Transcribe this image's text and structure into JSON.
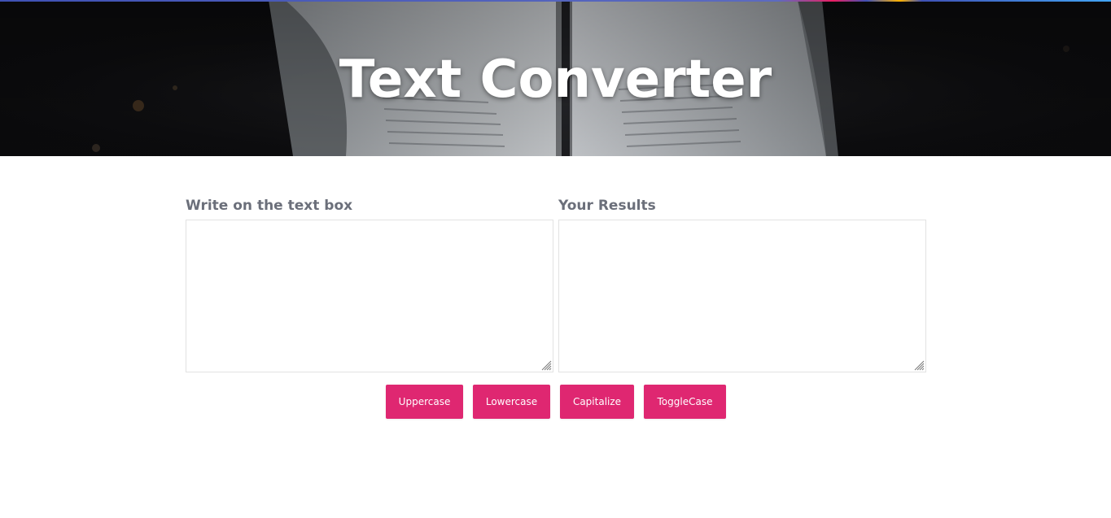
{
  "header": {
    "title": "Text Converter"
  },
  "converter": {
    "input_label": "Write on the text box",
    "output_label": "Your Results",
    "input_value": "",
    "output_value": ""
  },
  "actions": {
    "uppercase": "Uppercase",
    "lowercase": "Lowercase",
    "capitalize": "Capitalize",
    "togglecase": "ToggleCase"
  },
  "colors": {
    "button": "#df2771",
    "label": "#6b6f7a",
    "title": "#ffffff"
  }
}
